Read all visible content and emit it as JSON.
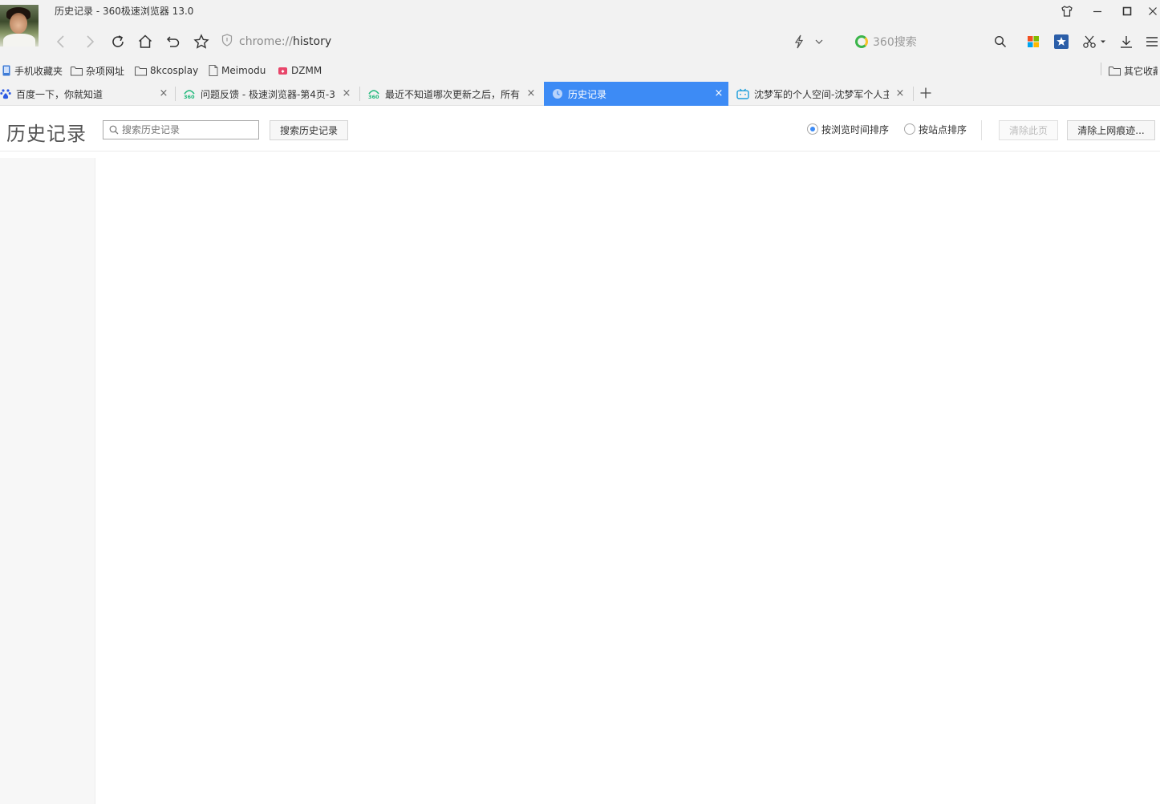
{
  "window": {
    "title": "历史记录 - 360极速浏览器 13.0"
  },
  "navbar": {
    "address_scheme": "chrome://",
    "address_path": "history",
    "search_engine": "360搜索"
  },
  "bookmarks": [
    {
      "label": "手机收藏夹",
      "icon": "phone-icon"
    },
    {
      "label": "杂项网址",
      "icon": "folder-icon"
    },
    {
      "label": "8kcosplay",
      "icon": "folder-icon"
    },
    {
      "label": "Meimodu",
      "icon": "page-icon"
    },
    {
      "label": "DZMM",
      "icon": "dzmm-icon"
    },
    {
      "label": "其它收藏",
      "icon": "folder-icon"
    }
  ],
  "tabs": [
    {
      "label": "百度一下，你就知道",
      "icon": "baidu-icon",
      "active": false
    },
    {
      "label": "问题反馈 - 极速浏览器-第4页-3",
      "icon": "360-icon",
      "active": false
    },
    {
      "label": "最近不知道哪次更新之后，所有",
      "icon": "360-icon",
      "active": false
    },
    {
      "label": "历史记录",
      "icon": "clock-icon",
      "active": true
    },
    {
      "label": "沈梦军的个人空间-沈梦军个人主",
      "icon": "bilibili-icon",
      "active": false
    }
  ],
  "history": {
    "title": "历史记录",
    "search_placeholder": "搜索历史记录",
    "search_button": "搜索历史记录",
    "sort_by_time": "按浏览时间排序",
    "sort_by_site": "按站点排序",
    "sort_selected": "time",
    "clear_page": "清除此页",
    "clear_traces": "清除上网痕迹..."
  },
  "colors": {
    "accent": "#3d8bf5",
    "chrome_bg": "#f2f2f2"
  }
}
